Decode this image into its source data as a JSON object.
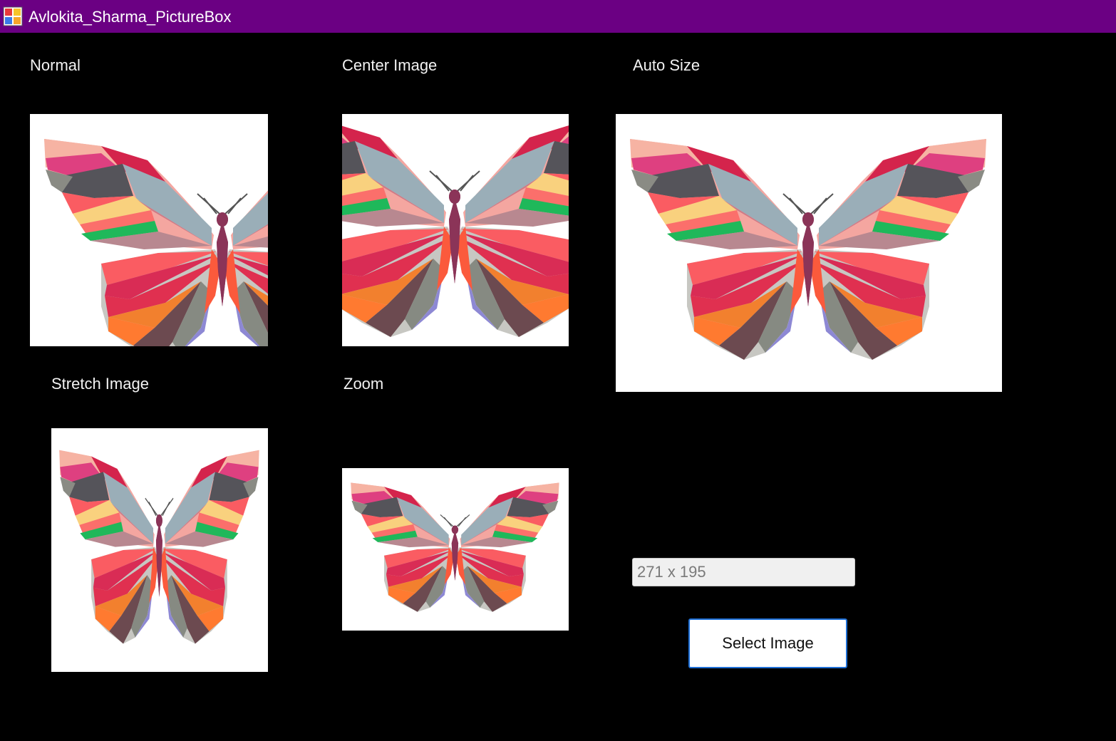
{
  "window": {
    "title": "Avlokita_Sharma_PictureBox",
    "title_bar_color": "#6b0083",
    "app_icon": "winforms-app-icon"
  },
  "labels": {
    "normal": "Normal",
    "center_image": "Center Image",
    "auto_size": "Auto Size",
    "stretch_image": "Stretch Image",
    "zoom": "Zoom"
  },
  "picture_boxes": [
    {
      "mode": "Normal",
      "image": "butterfly-image"
    },
    {
      "mode": "CenterImage",
      "image": "butterfly-image"
    },
    {
      "mode": "AutoSize",
      "image": "butterfly-image"
    },
    {
      "mode": "StretchImage",
      "image": "butterfly-image"
    },
    {
      "mode": "Zoom",
      "image": "butterfly-image"
    }
  ],
  "image_size_field": {
    "value": "271 x 195"
  },
  "select_button": {
    "label": "Select Image"
  },
  "colors": {
    "background": "#000000",
    "button_border": "#1e6fd6"
  }
}
